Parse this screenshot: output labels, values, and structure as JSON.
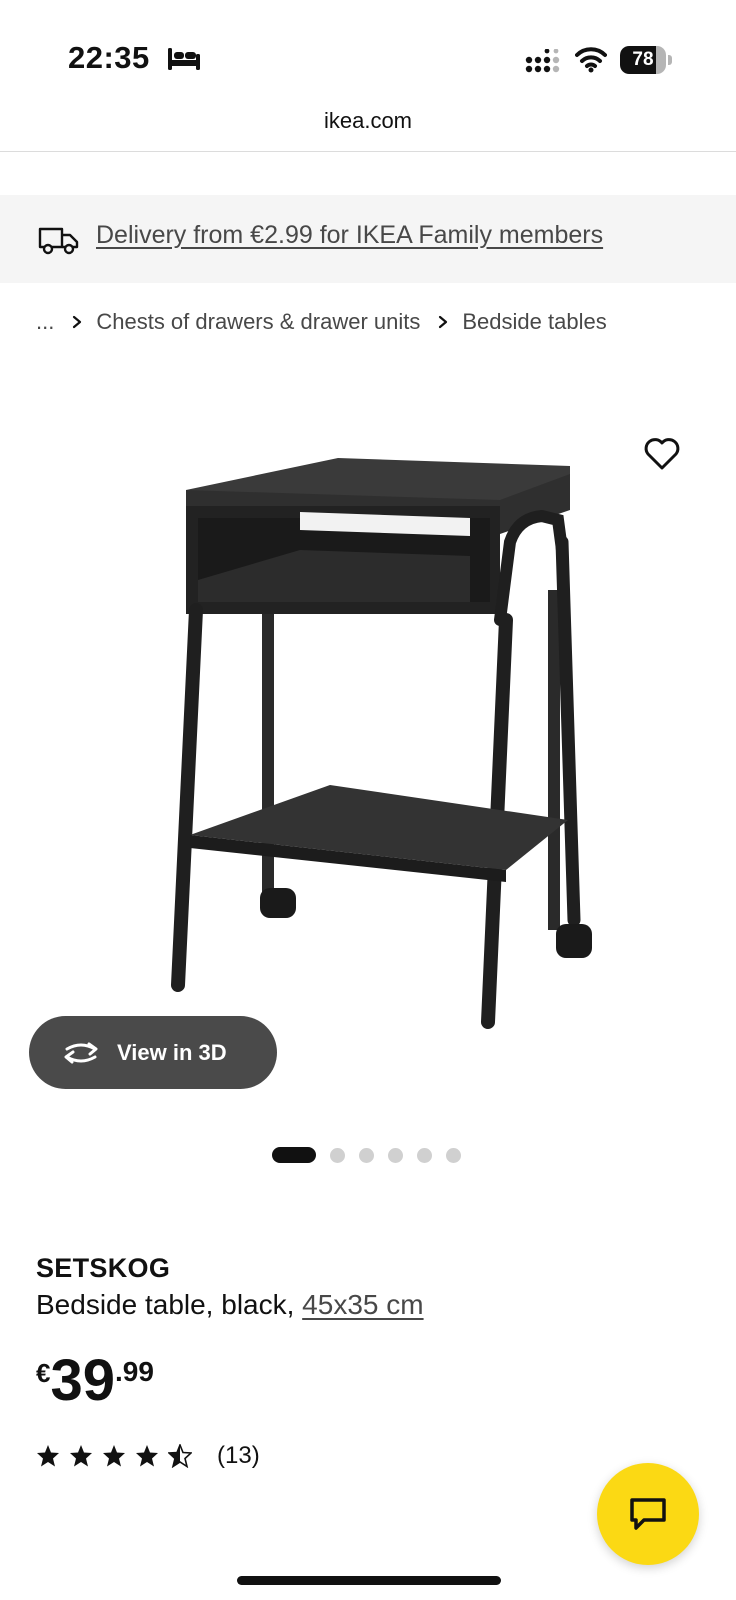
{
  "status_bar": {
    "time": "22:35",
    "focus_icon": "bed-icon",
    "signal_icon": "cellular-signal-icon",
    "wifi_icon": "wifi-icon",
    "battery_level": "78",
    "battery_fraction": 0.78
  },
  "browser": {
    "url": "ikea.com"
  },
  "delivery_banner": {
    "icon": "truck-icon",
    "text": "Delivery from €2.99 for IKEA Family members"
  },
  "breadcrumb": {
    "ellipsis": "...",
    "items": [
      "Chests of drawers & drawer units",
      "Bedside tables"
    ]
  },
  "product": {
    "image_alt": "SETSKOG bedside table, black",
    "favourite_icon": "heart-icon",
    "view_3d_label": "View in 3D",
    "carousel": {
      "total": 6,
      "active_index": 0
    },
    "name": "SETSKOG",
    "description": "Bedside table, black,",
    "size": "45x35 cm",
    "price": {
      "currency": "€",
      "integer": "39",
      "decimal": ".99"
    },
    "rating": {
      "value": 4.5,
      "max": 5,
      "review_count": "(13)"
    }
  },
  "chat": {
    "icon": "chat-icon"
  },
  "colors": {
    "chat_button": "#fbd914",
    "banner_bg": "#f5f5f5",
    "view3d_bg": "#4a4a4a",
    "text_primary": "#111111",
    "text_secondary": "#484848"
  }
}
